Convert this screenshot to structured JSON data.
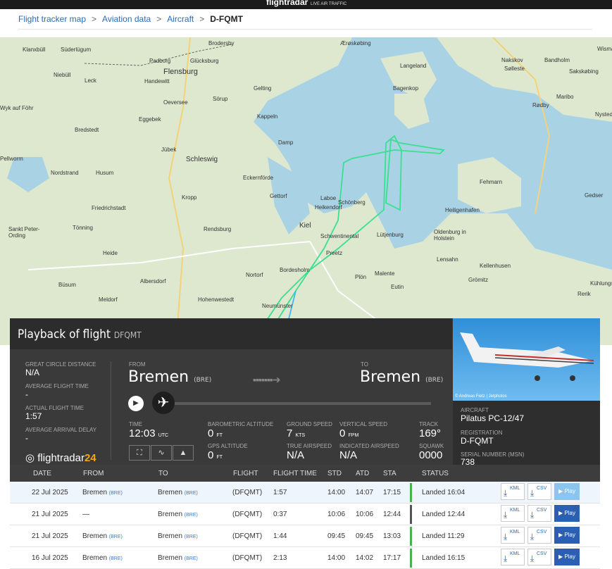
{
  "topbar": {
    "logo": "flightradar",
    "logo_sub": "LIVE AIR TRAFFIC"
  },
  "breadcrumb": {
    "items": [
      "Flight tracker map",
      "Aviation data",
      "Aircraft"
    ],
    "current": "D-FQMT",
    "sep": ">"
  },
  "map": {
    "places": [
      {
        "name": "Klanxbüll"
      },
      {
        "name": "Süderlügum"
      },
      {
        "name": "Padborg"
      },
      {
        "name": "Glücksburg"
      },
      {
        "name": "Flensburg"
      },
      {
        "name": "Niebüll"
      },
      {
        "name": "Leck"
      },
      {
        "name": "Handewitt"
      },
      {
        "name": "Gelting"
      },
      {
        "name": "Sörup"
      },
      {
        "name": "Oeversee"
      },
      {
        "name": "Kappeln"
      },
      {
        "name": "Bredstedt"
      },
      {
        "name": "Damp"
      },
      {
        "name": "Jübek"
      },
      {
        "name": "Schleswig"
      },
      {
        "name": "Nordstrand"
      },
      {
        "name": "Husum"
      },
      {
        "name": "Eckernförde"
      },
      {
        "name": "Gettorf"
      },
      {
        "name": "Laboe"
      },
      {
        "name": "Schönberg"
      },
      {
        "name": "Heikendorf"
      },
      {
        "name": "Kropp"
      },
      {
        "name": "Friedrichstadt"
      },
      {
        "name": "Kiel"
      },
      {
        "name": "Schwentinental"
      },
      {
        "name": "Lütjenburg"
      },
      {
        "name": "Rendsburg"
      },
      {
        "name": "Tönning"
      },
      {
        "name": "Sankt Peter-Ording"
      },
      {
        "name": "Preetz"
      },
      {
        "name": "Nortorf"
      },
      {
        "name": "Bordesholm"
      },
      {
        "name": "Plön"
      },
      {
        "name": "Malente"
      },
      {
        "name": "Eutin"
      },
      {
        "name": "Heide"
      },
      {
        "name": "Büsum"
      },
      {
        "name": "Albersdorf"
      },
      {
        "name": "Hohenwestedt"
      },
      {
        "name": "Neumünster"
      },
      {
        "name": "Meldorf"
      },
      {
        "name": "Fehmarn"
      },
      {
        "name": "Heiligenhafen"
      },
      {
        "name": "Oldenburg in Holstein"
      },
      {
        "name": "Lensahn"
      },
      {
        "name": "Kellenhusen"
      },
      {
        "name": "Grömitz"
      },
      {
        "name": "Nakskov"
      },
      {
        "name": "Sølleste"
      },
      {
        "name": "Bandholm"
      },
      {
        "name": "Sakskøbing"
      },
      {
        "name": "Maribo"
      },
      {
        "name": "Rødby"
      },
      {
        "name": "Nysted"
      },
      {
        "name": "Bagenkop"
      },
      {
        "name": "Langeland"
      },
      {
        "name": "Ærøskøbing"
      },
      {
        "name": "Brodersby"
      },
      {
        "name": "Eggebek"
      },
      {
        "name": "Wyk auf Föhr"
      },
      {
        "name": "Pellworm"
      },
      {
        "name": "Kühlungsborn"
      },
      {
        "name": "Rerik"
      },
      {
        "name": "Wismar"
      },
      {
        "name": "Gedser"
      }
    ]
  },
  "panel": {
    "title": "Playback of flight",
    "flight_code": "DFQMT",
    "close": "✕",
    "stats": [
      {
        "label": "GREAT CIRCLE DISTANCE",
        "value": "N/A"
      },
      {
        "label": "AVERAGE FLIGHT TIME",
        "value": "-"
      },
      {
        "label": "ACTUAL FLIGHT TIME",
        "value": "1:57"
      },
      {
        "label": "AVERAGE ARRIVAL DELAY",
        "value": "-"
      }
    ],
    "from_label": "FROM",
    "from_city": "Bremen",
    "from_code": "(BRE)",
    "to_label": "TO",
    "to_city": "Bremen",
    "to_code": "(BRE)",
    "play_icon": "▶",
    "plane_icon": "✈",
    "time_label": "TIME",
    "time_value": "12:03",
    "time_unit": "UTC",
    "baro_label": "BAROMETRIC ALTITUDE",
    "baro_value": "0",
    "baro_unit": "FT",
    "gps_label": "GPS ALTITUDE",
    "gps_value": "0",
    "gps_unit": "FT",
    "gs_label": "GROUND SPEED",
    "gs_value": "7",
    "gs_unit": "KTS",
    "tas_label": "TRUE AIRSPEED",
    "tas_value": "N/A",
    "vs_label": "VERTICAL SPEED",
    "vs_value": "0",
    "vs_unit": "FPM",
    "ias_label": "INDICATED AIRSPEED",
    "ias_value": "N/A",
    "track_label": "TRACK",
    "track_value": "169°",
    "squawk_label": "SQUAWK",
    "squawk_value": "0000",
    "brand_a": "flightradar",
    "brand_b": "24",
    "photo_credit": "© Andreas Fietz | Jetphotos",
    "aircraft_label": "AIRCRAFT",
    "aircraft_value": "Pilatus PC-12/47",
    "reg_label": "REGISTRATION",
    "reg_value": "D-FQMT",
    "msn_label": "SERIAL NUMBER (MSN)",
    "msn_value": "738"
  },
  "table": {
    "headers": [
      "DATE",
      "FROM",
      "TO",
      "FLIGHT",
      "FLIGHT TIME",
      "STD",
      "ATD",
      "STA",
      "STATUS"
    ],
    "rows": [
      {
        "date": "22 Jul 2025",
        "from": "Bremen",
        "from_code": "(BRE)",
        "to": "Bremen",
        "to_code": "(BRE)",
        "flight": "(DFQMT)",
        "ftime": "1:57",
        "std": "14:00",
        "atd": "14:07",
        "sta": "17:15",
        "status": "Landed 16:04"
      },
      {
        "date": "21 Jul 2025",
        "from": "—",
        "from_code": "",
        "to": "Bremen",
        "to_code": "(BRE)",
        "flight": "(DFQMT)",
        "ftime": "0:37",
        "std": "10:06",
        "atd": "10:06",
        "sta": "12:44",
        "status": "Landed 12:44"
      },
      {
        "date": "21 Jul 2025",
        "from": "Bremen",
        "from_code": "(BRE)",
        "to": "Bremen",
        "to_code": "(BRE)",
        "flight": "(DFQMT)",
        "ftime": "1:44",
        "std": "09:45",
        "atd": "09:45",
        "sta": "13:03",
        "status": "Landed 11:29"
      },
      {
        "date": "16 Jul 2025",
        "from": "Bremen",
        "from_code": "(BRE)",
        "to": "Bremen",
        "to_code": "(BRE)",
        "flight": "(DFQMT)",
        "ftime": "2:13",
        "std": "14:00",
        "atd": "14:02",
        "sta": "17:17",
        "status": "Landed 16:15"
      }
    ],
    "kml": "KML",
    "csv": "CSV",
    "play": "▶ Play"
  }
}
